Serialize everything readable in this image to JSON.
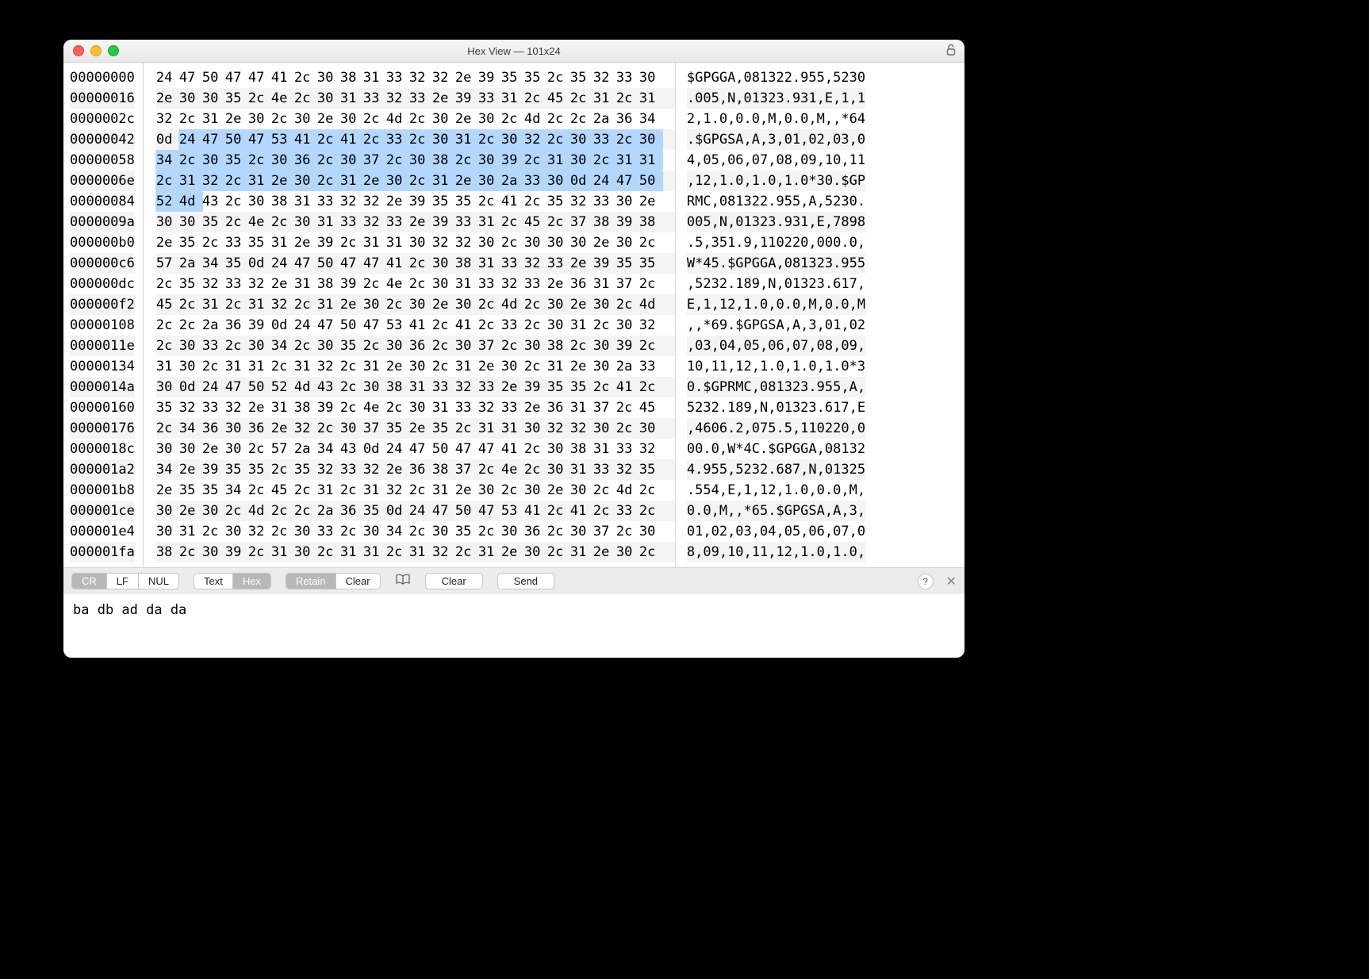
{
  "window": {
    "title": "Hex View — 101x24"
  },
  "bytes_per_row": 22,
  "highlight": {
    "start": 67,
    "end": 133
  },
  "offsets": [
    "00000000",
    "00000016",
    "0000002c",
    "00000042",
    "00000058",
    "0000006e",
    "00000084",
    "0000009a",
    "000000b0",
    "000000c6",
    "000000dc",
    "000000f2",
    "00000108",
    "0000011e",
    "00000134",
    "0000014a",
    "00000160",
    "00000176",
    "0000018c",
    "000001a2",
    "000001b8",
    "000001ce",
    "000001e4",
    "000001fa"
  ],
  "hex_rows": [
    [
      "24",
      "47",
      "50",
      "47",
      "47",
      "41",
      "2c",
      "30",
      "38",
      "31",
      "33",
      "32",
      "32",
      "2e",
      "39",
      "35",
      "35",
      "2c",
      "35",
      "32",
      "33",
      "30"
    ],
    [
      "2e",
      "30",
      "30",
      "35",
      "2c",
      "4e",
      "2c",
      "30",
      "31",
      "33",
      "32",
      "33",
      "2e",
      "39",
      "33",
      "31",
      "2c",
      "45",
      "2c",
      "31",
      "2c",
      "31"
    ],
    [
      "32",
      "2c",
      "31",
      "2e",
      "30",
      "2c",
      "30",
      "2e",
      "30",
      "2c",
      "4d",
      "2c",
      "30",
      "2e",
      "30",
      "2c",
      "4d",
      "2c",
      "2c",
      "2a",
      "36",
      "34"
    ],
    [
      "0d",
      "24",
      "47",
      "50",
      "47",
      "53",
      "41",
      "2c",
      "41",
      "2c",
      "33",
      "2c",
      "30",
      "31",
      "2c",
      "30",
      "32",
      "2c",
      "30",
      "33",
      "2c",
      "30"
    ],
    [
      "34",
      "2c",
      "30",
      "35",
      "2c",
      "30",
      "36",
      "2c",
      "30",
      "37",
      "2c",
      "30",
      "38",
      "2c",
      "30",
      "39",
      "2c",
      "31",
      "30",
      "2c",
      "31",
      "31"
    ],
    [
      "2c",
      "31",
      "32",
      "2c",
      "31",
      "2e",
      "30",
      "2c",
      "31",
      "2e",
      "30",
      "2c",
      "31",
      "2e",
      "30",
      "2a",
      "33",
      "30",
      "0d",
      "24",
      "47",
      "50"
    ],
    [
      "52",
      "4d",
      "43",
      "2c",
      "30",
      "38",
      "31",
      "33",
      "32",
      "32",
      "2e",
      "39",
      "35",
      "35",
      "2c",
      "41",
      "2c",
      "35",
      "32",
      "33",
      "30",
      "2e"
    ],
    [
      "30",
      "30",
      "35",
      "2c",
      "4e",
      "2c",
      "30",
      "31",
      "33",
      "32",
      "33",
      "2e",
      "39",
      "33",
      "31",
      "2c",
      "45",
      "2c",
      "37",
      "38",
      "39",
      "38"
    ],
    [
      "2e",
      "35",
      "2c",
      "33",
      "35",
      "31",
      "2e",
      "39",
      "2c",
      "31",
      "31",
      "30",
      "32",
      "32",
      "30",
      "2c",
      "30",
      "30",
      "30",
      "2e",
      "30",
      "2c"
    ],
    [
      "57",
      "2a",
      "34",
      "35",
      "0d",
      "24",
      "47",
      "50",
      "47",
      "47",
      "41",
      "2c",
      "30",
      "38",
      "31",
      "33",
      "32",
      "33",
      "2e",
      "39",
      "35",
      "35"
    ],
    [
      "2c",
      "35",
      "32",
      "33",
      "32",
      "2e",
      "31",
      "38",
      "39",
      "2c",
      "4e",
      "2c",
      "30",
      "31",
      "33",
      "32",
      "33",
      "2e",
      "36",
      "31",
      "37",
      "2c"
    ],
    [
      "45",
      "2c",
      "31",
      "2c",
      "31",
      "32",
      "2c",
      "31",
      "2e",
      "30",
      "2c",
      "30",
      "2e",
      "30",
      "2c",
      "4d",
      "2c",
      "30",
      "2e",
      "30",
      "2c",
      "4d"
    ],
    [
      "2c",
      "2c",
      "2a",
      "36",
      "39",
      "0d",
      "24",
      "47",
      "50",
      "47",
      "53",
      "41",
      "2c",
      "41",
      "2c",
      "33",
      "2c",
      "30",
      "31",
      "2c",
      "30",
      "32"
    ],
    [
      "2c",
      "30",
      "33",
      "2c",
      "30",
      "34",
      "2c",
      "30",
      "35",
      "2c",
      "30",
      "36",
      "2c",
      "30",
      "37",
      "2c",
      "30",
      "38",
      "2c",
      "30",
      "39",
      "2c"
    ],
    [
      "31",
      "30",
      "2c",
      "31",
      "31",
      "2c",
      "31",
      "32",
      "2c",
      "31",
      "2e",
      "30",
      "2c",
      "31",
      "2e",
      "30",
      "2c",
      "31",
      "2e",
      "30",
      "2a",
      "33"
    ],
    [
      "30",
      "0d",
      "24",
      "47",
      "50",
      "52",
      "4d",
      "43",
      "2c",
      "30",
      "38",
      "31",
      "33",
      "32",
      "33",
      "2e",
      "39",
      "35",
      "35",
      "2c",
      "41",
      "2c"
    ],
    [
      "35",
      "32",
      "33",
      "32",
      "2e",
      "31",
      "38",
      "39",
      "2c",
      "4e",
      "2c",
      "30",
      "31",
      "33",
      "32",
      "33",
      "2e",
      "36",
      "31",
      "37",
      "2c",
      "45"
    ],
    [
      "2c",
      "34",
      "36",
      "30",
      "36",
      "2e",
      "32",
      "2c",
      "30",
      "37",
      "35",
      "2e",
      "35",
      "2c",
      "31",
      "31",
      "30",
      "32",
      "32",
      "30",
      "2c",
      "30"
    ],
    [
      "30",
      "30",
      "2e",
      "30",
      "2c",
      "57",
      "2a",
      "34",
      "43",
      "0d",
      "24",
      "47",
      "50",
      "47",
      "47",
      "41",
      "2c",
      "30",
      "38",
      "31",
      "33",
      "32"
    ],
    [
      "34",
      "2e",
      "39",
      "35",
      "35",
      "2c",
      "35",
      "32",
      "33",
      "32",
      "2e",
      "36",
      "38",
      "37",
      "2c",
      "4e",
      "2c",
      "30",
      "31",
      "33",
      "32",
      "35"
    ],
    [
      "2e",
      "35",
      "35",
      "34",
      "2c",
      "45",
      "2c",
      "31",
      "2c",
      "31",
      "32",
      "2c",
      "31",
      "2e",
      "30",
      "2c",
      "30",
      "2e",
      "30",
      "2c",
      "4d",
      "2c"
    ],
    [
      "30",
      "2e",
      "30",
      "2c",
      "4d",
      "2c",
      "2c",
      "2a",
      "36",
      "35",
      "0d",
      "24",
      "47",
      "50",
      "47",
      "53",
      "41",
      "2c",
      "41",
      "2c",
      "33",
      "2c"
    ],
    [
      "30",
      "31",
      "2c",
      "30",
      "32",
      "2c",
      "30",
      "33",
      "2c",
      "30",
      "34",
      "2c",
      "30",
      "35",
      "2c",
      "30",
      "36",
      "2c",
      "30",
      "37",
      "2c",
      "30"
    ],
    [
      "38",
      "2c",
      "30",
      "39",
      "2c",
      "31",
      "30",
      "2c",
      "31",
      "31",
      "2c",
      "31",
      "32",
      "2c",
      "31",
      "2e",
      "30",
      "2c",
      "31",
      "2e",
      "30",
      "2c"
    ]
  ],
  "ascii_rows": [
    "$GPGGA,081322.955,5230",
    ".005,N,01323.931,E,1,1",
    "2,1.0,0.0,M,0.0,M,,*64",
    ".$GPGSA,A,3,01,02,03,0",
    "4,05,06,07,08,09,10,11",
    ",12,1.0,1.0,1.0*30.$GP",
    "RMC,081322.955,A,5230.",
    "005,N,01323.931,E,7898",
    ".5,351.9,110220,000.0,",
    "W*45.$GPGGA,081323.955",
    ",5232.189,N,01323.617,",
    "E,1,12,1.0,0.0,M,0.0,M",
    ",,*69.$GPGSA,A,3,01,02",
    ",03,04,05,06,07,08,09,",
    "10,11,12,1.0,1.0,1.0*3",
    "0.$GPRMC,081323.955,A,",
    "5232.189,N,01323.617,E",
    ",4606.2,075.5,110220,0",
    "00.0,W*4C.$GPGGA,08132",
    "4.955,5232.687,N,01325",
    ".554,E,1,12,1.0,0.0,M,",
    "0.0,M,,*65.$GPGSA,A,3,",
    "01,02,03,04,05,06,07,0",
    "8,09,10,11,12,1.0,1.0,"
  ],
  "toolbar": {
    "line_ending": {
      "options": [
        "CR",
        "LF",
        "NUL"
      ],
      "selected": "CR"
    },
    "mode": {
      "options": [
        "Text",
        "Hex"
      ],
      "selected": "Hex"
    },
    "retain": "Retain",
    "clear1": "Clear",
    "clear2": "Clear",
    "send": "Send",
    "help": "?"
  },
  "input": {
    "value": "ba db ad da da"
  }
}
